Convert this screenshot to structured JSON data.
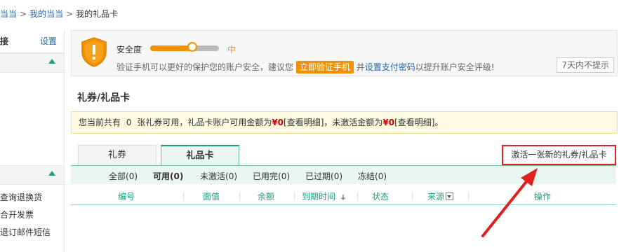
{
  "breadcrumb": {
    "item1": "当当",
    "item2": "我的当当",
    "item3": "我的礼品卡",
    "sep": ">"
  },
  "sidebar": {
    "header_left": "接",
    "header_right": "设置",
    "links": [
      "查询退换货",
      "合开发票",
      "退订邮件短信"
    ]
  },
  "security": {
    "label": "安全度",
    "level": "中",
    "progress_fraction": 0.6,
    "tip_before": "验证手机可以更好的保护您的账户安全，建议您",
    "verify_button": "立即验证手机",
    "tip_mid": "并",
    "pay_password_link": "设置支付密码",
    "tip_after": "以提升账户安全评级!",
    "no_remind_button": "7天内不提示"
  },
  "page_title": "礼券/礼品卡",
  "notice": {
    "part1": "您当前共有",
    "coupon_count": "0",
    "part2": "张礼券可用，礼品卡账户可用金额为",
    "available_amount": "¥0",
    "detail1": "[查看明细]",
    "part3": "，未激活金额为",
    "inactive_amount": "¥0",
    "detail2": "[查看明细]",
    "end": "。"
  },
  "tabs": {
    "coupon": "礼券",
    "gift_card": "礼品卡"
  },
  "activate_link": "激活一张新的礼券/礼品卡",
  "filters": [
    {
      "label": "全部",
      "count": "(0)"
    },
    {
      "label": "可用",
      "count": "(0)"
    },
    {
      "label": "未激活",
      "count": "(0)"
    },
    {
      "label": "已用完",
      "count": "(0)"
    },
    {
      "label": "已过期",
      "count": "(0)"
    },
    {
      "label": "冻结",
      "count": "(0)"
    }
  ],
  "columns": {
    "number": "编号",
    "face_value": "面值",
    "balance": "余额",
    "expiry": "到期时间",
    "expiry_sort_icon": "down-arrow-icon",
    "status": "状态",
    "source": "来源",
    "actions": "操作"
  },
  "colors": {
    "accent": "#19a17e",
    "orange": "#f29100",
    "highlight_red": "#e02020",
    "amount_red": "#cc0000"
  }
}
